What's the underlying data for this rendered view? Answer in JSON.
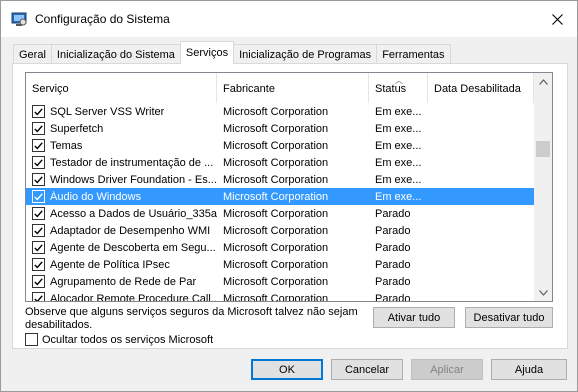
{
  "window": {
    "title": "Configuração do Sistema"
  },
  "tabs": [
    {
      "label": "Geral",
      "active": false
    },
    {
      "label": "Inicialização do Sistema",
      "active": false
    },
    {
      "label": "Serviços",
      "active": true
    },
    {
      "label": "Inicialização de Programas",
      "active": false
    },
    {
      "label": "Ferramentas",
      "active": false
    }
  ],
  "services": {
    "columns": [
      "Serviço",
      "Fabricante",
      "Status",
      "Data Desabilitada"
    ],
    "rows": [
      {
        "name": "SQL Server VSS Writer",
        "maker": "Microsoft Corporation",
        "status": "Em exe...",
        "date": "",
        "checked": true,
        "selected": false
      },
      {
        "name": "Superfetch",
        "maker": "Microsoft Corporation",
        "status": "Em exe...",
        "date": "",
        "checked": true,
        "selected": false
      },
      {
        "name": "Temas",
        "maker": "Microsoft Corporation",
        "status": "Em exe...",
        "date": "",
        "checked": true,
        "selected": false
      },
      {
        "name": "Testador de instrumentação de ...",
        "maker": "Microsoft Corporation",
        "status": "Em exe...",
        "date": "",
        "checked": true,
        "selected": false
      },
      {
        "name": "Windows Driver Foundation - Es...",
        "maker": "Microsoft Corporation",
        "status": "Em exe...",
        "date": "",
        "checked": true,
        "selected": false
      },
      {
        "name": "Áudio do Windows",
        "maker": "Microsoft Corporation",
        "status": "Em exe...",
        "date": "",
        "checked": true,
        "selected": true
      },
      {
        "name": "Acesso a Dados de Usuário_335ac",
        "maker": "Microsoft Corporation",
        "status": "Parado",
        "date": "",
        "checked": true,
        "selected": false
      },
      {
        "name": "Adaptador de Desempenho WMI",
        "maker": "Microsoft Corporation",
        "status": "Parado",
        "date": "",
        "checked": true,
        "selected": false
      },
      {
        "name": "Agente de Descoberta em Segu...",
        "maker": "Microsoft Corporation",
        "status": "Parado",
        "date": "",
        "checked": true,
        "selected": false
      },
      {
        "name": "Agente de Política IPsec",
        "maker": "Microsoft Corporation",
        "status": "Parado",
        "date": "",
        "checked": true,
        "selected": false
      },
      {
        "name": "Agrupamento de Rede de Par",
        "maker": "Microsoft Corporation",
        "status": "Parado",
        "date": "",
        "checked": true,
        "selected": false
      },
      {
        "name": "Alocador Remote Procedure Call...",
        "maker": "Microsoft Corporation",
        "status": "Parado",
        "date": "",
        "checked": true,
        "selected": false
      }
    ]
  },
  "note": "Observe que alguns serviços seguros da Microsoft talvez não sejam desabilitados.",
  "buttons": {
    "enable_all": "Ativar tudo",
    "disable_all": "Desativar tudo",
    "ok": "OK",
    "cancel": "Cancelar",
    "apply": "Aplicar",
    "help": "Ajuda"
  },
  "hide_ms": {
    "label": "Ocultar todos os serviços Microsoft",
    "checked": false
  },
  "colors": {
    "selection": "#3399ff",
    "default_button_border": "#0078d7"
  }
}
